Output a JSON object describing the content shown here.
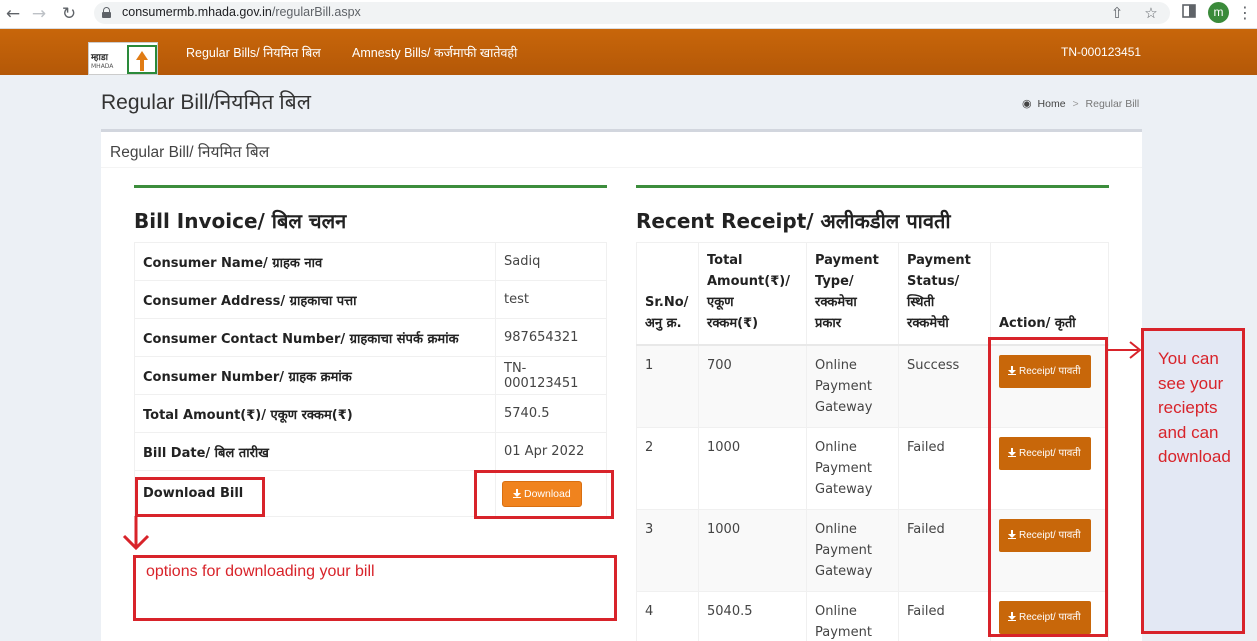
{
  "browser": {
    "url_host": "consumermb.mhada.gov.in",
    "url_path": "/regularBill.aspx",
    "profile_initial": "m",
    "icons": [
      "back-icon",
      "forward-icon",
      "reload-icon",
      "lock-icon",
      "share-icon",
      "star-icon",
      "sidepanel-icon",
      "menu-icon"
    ]
  },
  "header": {
    "logo_text": "म्हाडा",
    "logo_sub": "MHADA",
    "nav": [
      "Regular Bills/ नियमित बिल",
      "Amnesty Bills/ कर्जमाफी खातेवही"
    ],
    "account": "TN-000123451"
  },
  "page": {
    "title": "Regular Bill/नियमित बिल",
    "breadcrumb": {
      "home": "Home",
      "current": "Regular Bill"
    },
    "box_title": "Regular Bill/ नियमित बिल"
  },
  "invoice": {
    "title": "Bill Invoice/ बिल चलन",
    "rows": [
      {
        "label": "Consumer Name/ ग्राहक नाव",
        "value": "Sadiq"
      },
      {
        "label": "Consumer Address/ ग्राहकाचा पत्ता",
        "value": "test"
      },
      {
        "label": "Consumer Contact Number/ ग्राहकाचा संपर्क क्रमांक",
        "value": "987654321"
      },
      {
        "label": "Consumer Number/ ग्राहक क्रमांक",
        "value": "TN-000123451"
      },
      {
        "label": "Total Amount(₹)/ एकूण रक्कम(₹)",
        "value": "5740.5"
      },
      {
        "label": "Bill Date/ बिल तारीख",
        "value": "01 Apr 2022"
      }
    ],
    "download_label": "Download Bill",
    "download_button": "Download"
  },
  "receipts": {
    "title": "Recent Receipt/ अलीकडील पावती",
    "headers": {
      "sr": [
        "Sr.No/",
        "अनु क्र."
      ],
      "amount": [
        "Total",
        "Amount(₹)/",
        "एकूण",
        "रक्कम(₹)"
      ],
      "type": [
        "Payment",
        "Type/",
        "रक्कमेचा",
        "प्रकार"
      ],
      "status": [
        "Payment",
        "Status/",
        "स्थिती",
        "रक्कमेची"
      ],
      "action": [
        "Action/ कृती"
      ]
    },
    "rows": [
      {
        "sr": "1",
        "amount": "700",
        "type": [
          "Online",
          "Payment",
          "Gateway"
        ],
        "status": "Success",
        "button": "Receipt/ पावती"
      },
      {
        "sr": "2",
        "amount": "1000",
        "type": [
          "Online",
          "Payment",
          "Gateway"
        ],
        "status": "Failed",
        "button": "Receipt/ पावती"
      },
      {
        "sr": "3",
        "amount": "1000",
        "type": [
          "Online",
          "Payment",
          "Gateway"
        ],
        "status": "Failed",
        "button": "Receipt/ पावती"
      },
      {
        "sr": "4",
        "amount": "5040.5",
        "type": [
          "Online",
          "Payment"
        ],
        "status": "Failed",
        "button": "Receipt/ पावती"
      }
    ]
  },
  "annotations": {
    "download_note": "options for downloading your bill",
    "receipt_note": [
      "You can",
      "see your",
      "reciepts",
      "and can",
      "download"
    ],
    "color": "#d8232a"
  }
}
